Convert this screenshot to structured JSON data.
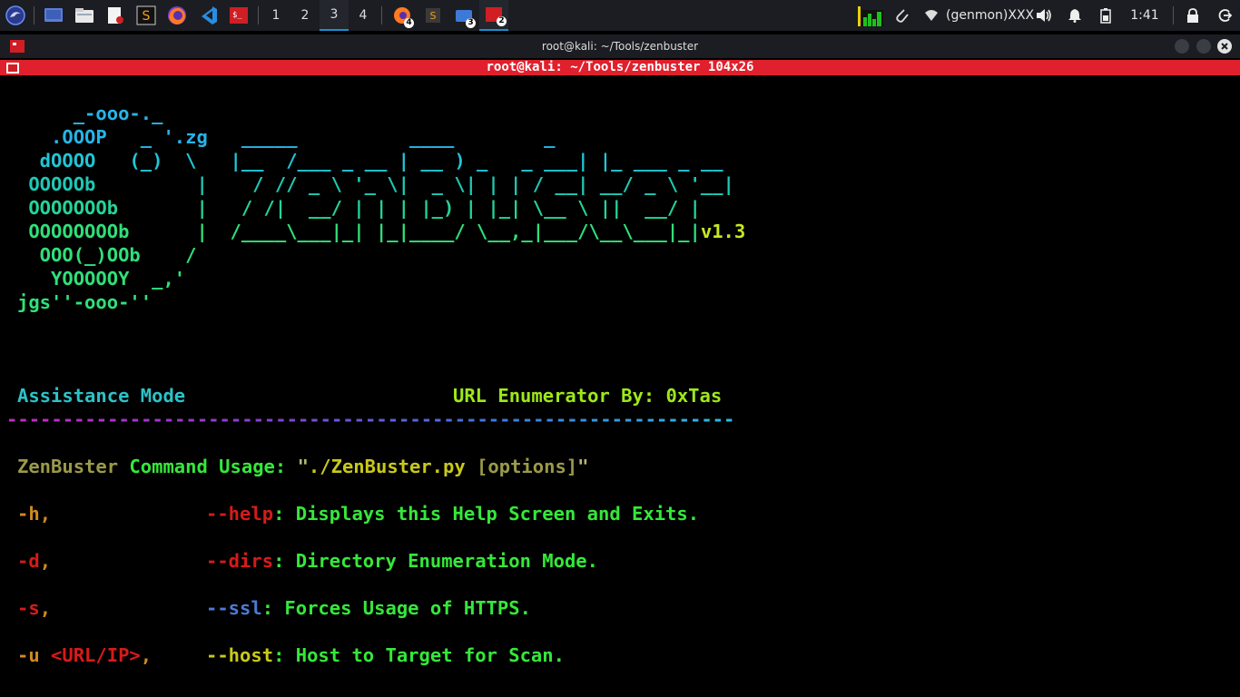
{
  "panel": {
    "workspaces": [
      "1",
      "2",
      "3",
      "4"
    ],
    "active_workspace": "3",
    "task_badges": [
      "4",
      "3",
      "2"
    ],
    "genmon": "(genmon)XXX",
    "clock": "1:41"
  },
  "window": {
    "title": "root@kali: ~/Tools/zenbuster",
    "term_title": "root@kali: ~/Tools/zenbuster 104x26"
  },
  "terminal": {
    "banner": [
      "     _-ooo-._",
      "   .OOOP   _ '.zg   _____          ____        _",
      "  dOOOO   (_)  \\   |__  /___ _ __ | __ ) _   _ ___| |_ ___ _ __",
      " OOOOOb         |    / // _ \\ '_ \\|  _ \\| | | / __| __/ _ \\ '__|",
      " OOOOOOOb       |   / /|  __/ | | | |_) | |_| \\__ \\ ||  __/ |",
      " OOOOOOOOb      |  /____\\___|_| |_|____/ \\__,_|___/\\__\\___|_|",
      "  OOO(_)OOb    /",
      "   YOOOOOY  _,'",
      "jgs''-ooo-''"
    ],
    "version": "v1.3",
    "mode_label": "Assistance Mode",
    "author_label": "URL Enumerator By: 0xTas",
    "separator": "-----------------------------------------------------------------",
    "usage": {
      "name": "ZenBuster",
      "label": " Command Usage: ",
      "q1": "\"",
      "cmd": "./ZenBuster.py",
      "opts": " [options]",
      "q2": "\""
    },
    "options": [
      {
        "short": "-h",
        "arg": "",
        "comma": ",",
        "long": "--help",
        "desc": ": Displays this Help Screen and Exits."
      },
      {
        "short": "-d",
        "arg": "",
        "comma": ",",
        "long": "--dirs",
        "desc": ": Directory Enumeration Mode."
      },
      {
        "short": "-s",
        "arg": "",
        "comma": ",",
        "long": "--ssl",
        "desc": ": Forces Usage of HTTPS."
      },
      {
        "short": "-u",
        "arg": " <URL/IP>",
        "comma": ",",
        "long": "--host",
        "desc": ": Host to Target for Scan."
      }
    ]
  }
}
